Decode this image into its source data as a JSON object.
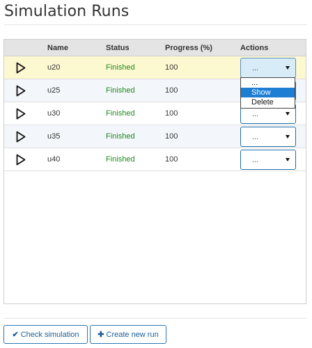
{
  "page": {
    "title": "Simulation Runs"
  },
  "table": {
    "headers": {
      "name": "Name",
      "status": "Status",
      "progress": "Progress (%)",
      "actions": "Actions"
    },
    "rows": [
      {
        "name": "u20",
        "status": "Finished",
        "progress": "100",
        "action": "..."
      },
      {
        "name": "u25",
        "status": "Finished",
        "progress": "100",
        "action": "..."
      },
      {
        "name": "u30",
        "status": "Finished",
        "progress": "100",
        "action": "..."
      },
      {
        "name": "u35",
        "status": "Finished",
        "progress": "100",
        "action": "..."
      },
      {
        "name": "u40",
        "status": "Finished",
        "progress": "100",
        "action": "..."
      }
    ]
  },
  "dropdown": {
    "options": [
      "...",
      "Show",
      "Delete"
    ],
    "highlighted": "Show"
  },
  "footer": {
    "check_label": "Check simulation",
    "create_label": "Create new run",
    "check_icon": "check-icon",
    "create_icon": "plus-icon"
  },
  "colors": {
    "accent": "#2a76b4",
    "status_finished": "#1e8a1e",
    "selected_row": "#fcf8d0",
    "highlight": "#1e7ed4"
  }
}
